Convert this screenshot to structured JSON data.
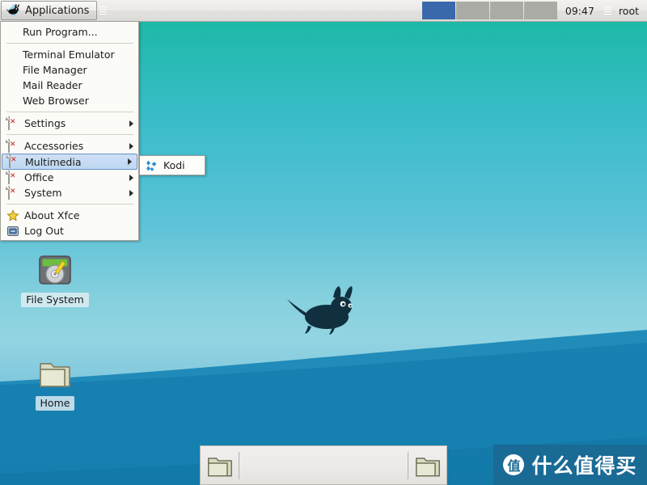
{
  "panel": {
    "applications_label": "Applications",
    "applications_icon": "xfce-mouse-icon",
    "clock": "09:47",
    "user": "root",
    "workspaces": [
      {
        "name": "workspace-1",
        "active": true
      },
      {
        "name": "workspace-2",
        "active": false
      },
      {
        "name": "workspace-3",
        "active": false
      },
      {
        "name": "workspace-4",
        "active": false
      }
    ],
    "accent_active": "#3a69ab",
    "workspace_idle": "#aaaba4"
  },
  "menu": {
    "items": [
      {
        "label": "Run Program...",
        "icon": null,
        "submenu": false
      },
      {
        "label": "Terminal Emulator",
        "icon": null,
        "submenu": false
      },
      {
        "label": "File Manager",
        "icon": null,
        "submenu": false
      },
      {
        "label": "Mail Reader",
        "icon": null,
        "submenu": false
      },
      {
        "label": "Web Browser",
        "icon": null,
        "submenu": false
      },
      {
        "label": "Settings",
        "icon": "broken-image-icon",
        "submenu": true
      },
      {
        "label": "Accessories",
        "icon": "broken-image-icon",
        "submenu": true
      },
      {
        "label": "Multimedia",
        "icon": "broken-image-icon",
        "submenu": true
      },
      {
        "label": "Office",
        "icon": "broken-image-icon",
        "submenu": true
      },
      {
        "label": "System",
        "icon": "broken-image-icon",
        "submenu": true
      },
      {
        "label": "About Xfce",
        "icon": "star-icon",
        "submenu": false
      },
      {
        "label": "Log Out",
        "icon": "logout-icon",
        "submenu": false
      }
    ],
    "selected": "Multimedia",
    "highlight_color": "#bed7f2"
  },
  "submenu": {
    "title": "Multimedia",
    "items": [
      {
        "label": "Kodi",
        "icon": "kodi-icon"
      }
    ]
  },
  "desktop": {
    "icons": [
      {
        "label": "File System",
        "icon": "harddisk-icon"
      },
      {
        "label": "Home",
        "icon": "folder-icon"
      }
    ],
    "wallpaper_logo": "xfce-mouse-icon"
  },
  "dock": {
    "items": [
      {
        "name": "folder-launcher-left",
        "icon": "folder-icon"
      },
      {
        "name": "folder-launcher-right",
        "icon": "folder-icon"
      }
    ]
  },
  "watermark": {
    "badge": "值",
    "text": "什么值得买",
    "color": "#1a6a96"
  }
}
